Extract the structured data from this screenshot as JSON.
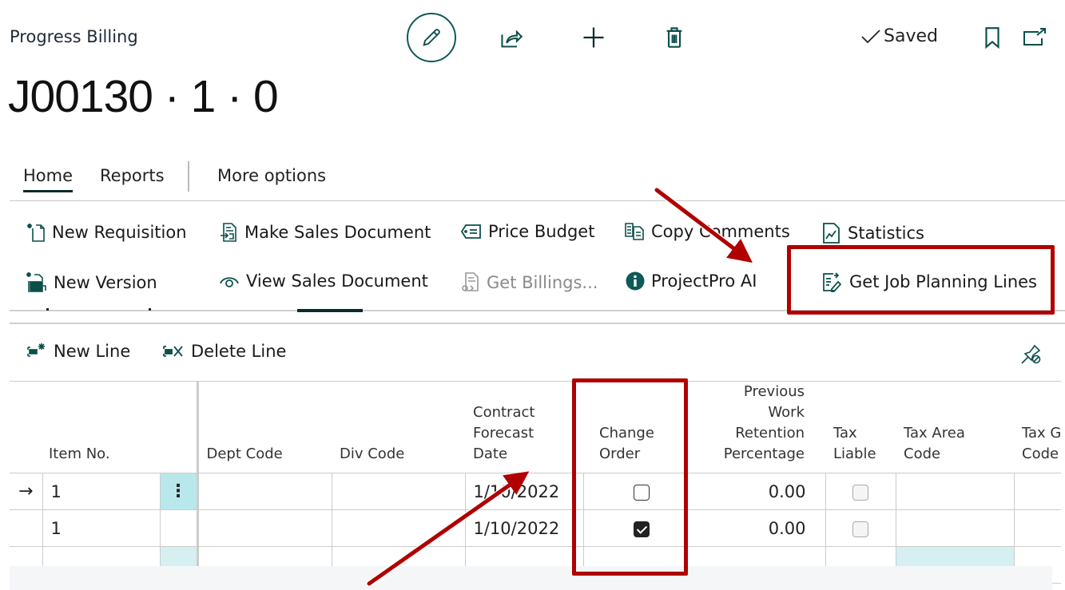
{
  "header": {
    "caption": "Progress Billing",
    "title": "J00130 · 1 · 0",
    "saved_status": "Saved",
    "icons": [
      "edit-icon",
      "share-icon",
      "plus-icon",
      "trash-icon",
      "check-icon",
      "bookmark-icon",
      "popout-icon"
    ]
  },
  "tabs": [
    {
      "label": "Home",
      "active": true
    },
    {
      "label": "Reports",
      "active": false
    },
    {
      "label": "More options",
      "active": false
    }
  ],
  "actions": {
    "row1": [
      {
        "label": "New Requisition",
        "icon": "new-document-icon"
      },
      {
        "label": "Make Sales Document",
        "icon": "make-document-icon"
      },
      {
        "label": "Price Budget",
        "icon": "price-tag-icon"
      },
      {
        "label": "Copy Comments",
        "icon": "copy-icon"
      },
      {
        "label": "Statistics",
        "icon": "statistics-icon"
      }
    ],
    "row2": [
      {
        "label": "New Version",
        "icon": "new-version-icon"
      },
      {
        "label": "View Sales Document",
        "icon": "eye-icon"
      },
      {
        "label": "Get Billings...",
        "icon": "get-billings-icon",
        "disabled": true
      },
      {
        "label": "ProjectPro AI",
        "icon": "info-icon"
      },
      {
        "label": "Get Job Planning Lines",
        "icon": "get-lines-icon"
      }
    ]
  },
  "lines": {
    "new_line": "New Line",
    "delete_line": "Delete Line",
    "columns": [
      "Item No.",
      "Dept Code",
      "Div Code",
      "Contract Forecast Date",
      "Change Order",
      "Previous Work Retention Percentage",
      "Tax Liable",
      "Tax Area Code",
      "Tax Group Code"
    ],
    "column_lines": {
      "contract": [
        "Contract",
        "Forecast",
        "Date"
      ],
      "change": [
        "Change",
        "Order"
      ],
      "prev": [
        "Previous Work",
        "Retention",
        "Percentage"
      ],
      "taxliable": [
        "Tax",
        "Liable"
      ],
      "taxarea": [
        "Tax Area",
        "Code"
      ],
      "taxgroup": [
        "Tax G",
        "Code"
      ]
    },
    "rows": [
      {
        "current": true,
        "item_no": "1",
        "dept_code": "",
        "div_code": "",
        "forecast_date": "1/10/2022",
        "change_order": false,
        "retention_pct": "0.00",
        "tax_liable": false,
        "tax_area": "",
        "tax_group": ""
      },
      {
        "current": false,
        "item_no": "1",
        "dept_code": "",
        "div_code": "",
        "forecast_date": "1/10/2022",
        "change_order": true,
        "retention_pct": "0.00",
        "tax_liable": false,
        "tax_area": "",
        "tax_group": ""
      },
      {
        "current": false,
        "item_no": "",
        "dept_code": "",
        "div_code": "",
        "forecast_date": "",
        "change_order": null,
        "retention_pct": "",
        "tax_liable": null,
        "tax_area": "",
        "tax_group": ""
      }
    ],
    "current_row_marker": "→",
    "row_menu": "⋮"
  },
  "annotations": {
    "color": "#b00000",
    "highlights": [
      "Get Job Planning Lines",
      "Change Order column"
    ]
  }
}
